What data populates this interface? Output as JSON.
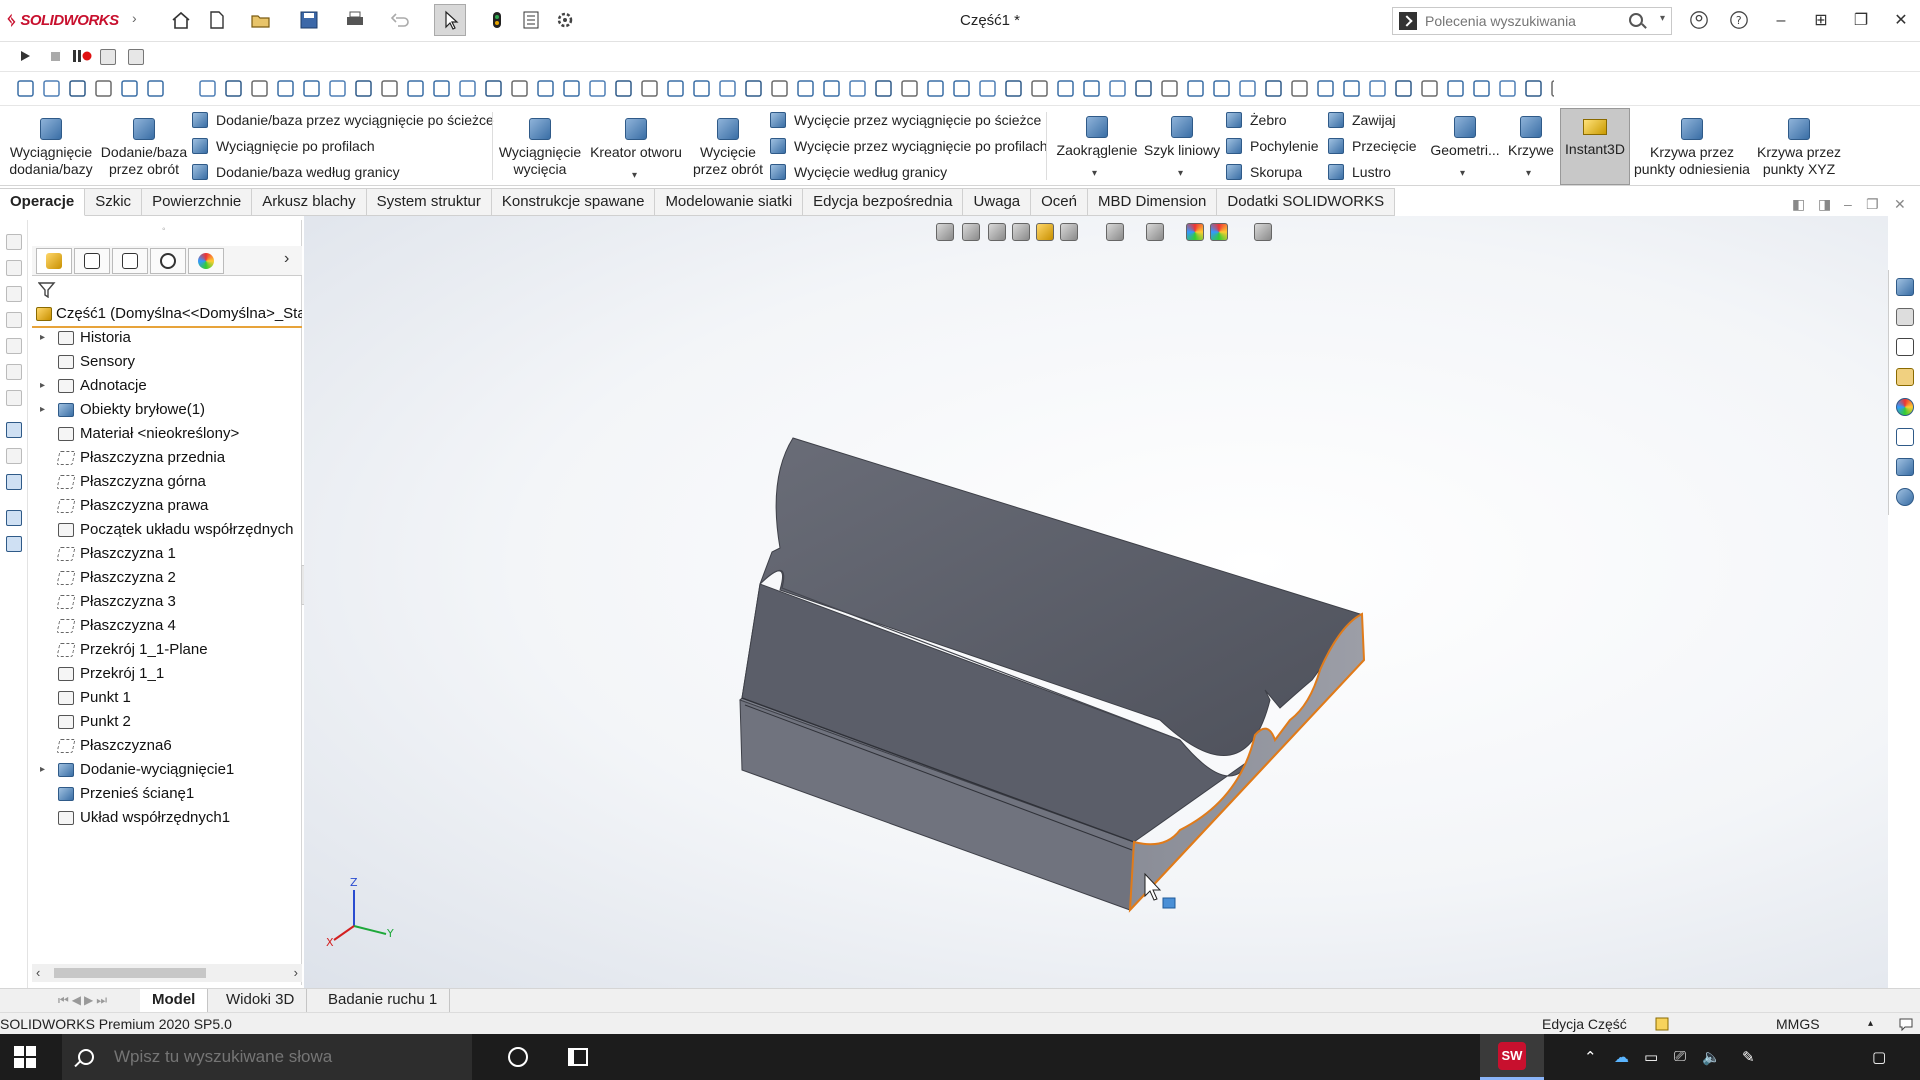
{
  "app": {
    "brand": "SOLIDWORKS",
    "title": "Część1 *",
    "search_placeholder": "Polecenia wyszukiwania"
  },
  "ribbon": {
    "extrude_boss": "Wyciągnięcie dodania/bazy",
    "revolve_boss": "Dodanie/baza przez obrót",
    "sweep_boss": "Dodanie/baza przez wyciągnięcie po ścieżce",
    "loft_boss": "Wyciągnięcie po profilach",
    "boundary_boss": "Dodanie/baza według granicy",
    "extrude_cut": "Wyciągnięcie wycięcia",
    "hole_wizard": "Kreator otworu",
    "revolve_cut": "Wycięcie przez obrót",
    "sweep_cut": "Wycięcie przez wyciągnięcie po ścieżce",
    "loft_cut": "Wycięcie przez wyciągnięcie po profilach",
    "boundary_cut": "Wycięcie według granicy",
    "fillet": "Zaokrąglenie",
    "linear_pattern": "Szyk liniowy",
    "rib": "Żebro",
    "draft": "Pochylenie",
    "shell": "Skorupa",
    "wrap": "Zawijaj",
    "intersect": "Przecięcie",
    "mirror": "Lustro",
    "ref_geometry": "Geometri...",
    "curves": "Krzywe",
    "instant3d": "Instant3D",
    "curve_ref_points": "Krzywa przez punkty odniesienia",
    "curve_xyz": "Krzywa przez punkty XYZ"
  },
  "tabs": [
    "Operacje",
    "Szkic",
    "Powierzchnie",
    "Arkusz blachy",
    "System struktur",
    "Konstrukcje spawane",
    "Modelowanie siatki",
    "Edycja bezpośrednia",
    "Uwaga",
    "Oceń",
    "MBD Dimension",
    "Dodatki SOLIDWORKS"
  ],
  "tree": {
    "root": "Część1  (Domyślna<<Domyślna>_Sta",
    "items": [
      {
        "label": "Historia",
        "expandable": true,
        "icon": "history-icon"
      },
      {
        "label": "Sensory",
        "expandable": false,
        "icon": "sensors-icon"
      },
      {
        "label": "Adnotacje",
        "expandable": true,
        "icon": "annotations-icon"
      },
      {
        "label": "Obiekty bryłowe(1)",
        "expandable": true,
        "icon": "solid-bodies-icon"
      },
      {
        "label": "Materiał <nieokreślony>",
        "expandable": false,
        "icon": "material-icon"
      },
      {
        "label": "Płaszczyzna przednia",
        "expandable": false,
        "icon": "plane-icon"
      },
      {
        "label": "Płaszczyzna górna",
        "expandable": false,
        "icon": "plane-icon"
      },
      {
        "label": "Płaszczyzna prawa",
        "expandable": false,
        "icon": "plane-icon"
      },
      {
        "label": "Początek układu współrzędnych",
        "expandable": false,
        "icon": "origin-icon"
      },
      {
        "label": "Płaszczyzna 1",
        "expandable": false,
        "icon": "plane-icon"
      },
      {
        "label": "Płaszczyzna 2",
        "expandable": false,
        "icon": "plane-icon"
      },
      {
        "label": "Płaszczyzna 3",
        "expandable": false,
        "icon": "plane-icon"
      },
      {
        "label": "Płaszczyzna 4",
        "expandable": false,
        "icon": "plane-icon"
      },
      {
        "label": "Przekrój 1_1-Plane",
        "expandable": false,
        "icon": "plane-icon"
      },
      {
        "label": "Przekrój 1_1",
        "expandable": false,
        "icon": "sketch-icon"
      },
      {
        "label": "Punkt 1",
        "expandable": false,
        "icon": "point-3d-icon"
      },
      {
        "label": "Punkt 2",
        "expandable": false,
        "icon": "point-3d-icon"
      },
      {
        "label": "Płaszczyzna6",
        "expandable": false,
        "icon": "plane-icon"
      },
      {
        "label": "Dodanie-wyciągnięcie1",
        "expandable": true,
        "icon": "extrude-icon"
      },
      {
        "label": "Przenieś ścianę1",
        "expandable": false,
        "icon": "move-face-icon"
      },
      {
        "label": "Układ współrzędnych1",
        "expandable": false,
        "icon": "coordinate-system-icon"
      }
    ]
  },
  "triad": {
    "x": "X",
    "y": "Y",
    "z": "Z"
  },
  "bottom_tabs": [
    "Model",
    "Widoki 3D",
    "Badanie ruchu 1"
  ],
  "status": {
    "version": "SOLIDWORKS Premium 2020 SP5.0",
    "mode": "Edycja Część",
    "units": "MMGS"
  },
  "taskbar": {
    "search_placeholder": "Wpisz tu wyszukiwane słowa",
    "sw_badge": "SW"
  },
  "colors": {
    "brand": "#c8102e",
    "model_face": "#5d606b",
    "model_edge": "#e07b1a",
    "selection_blue": "#2d6fb8"
  }
}
